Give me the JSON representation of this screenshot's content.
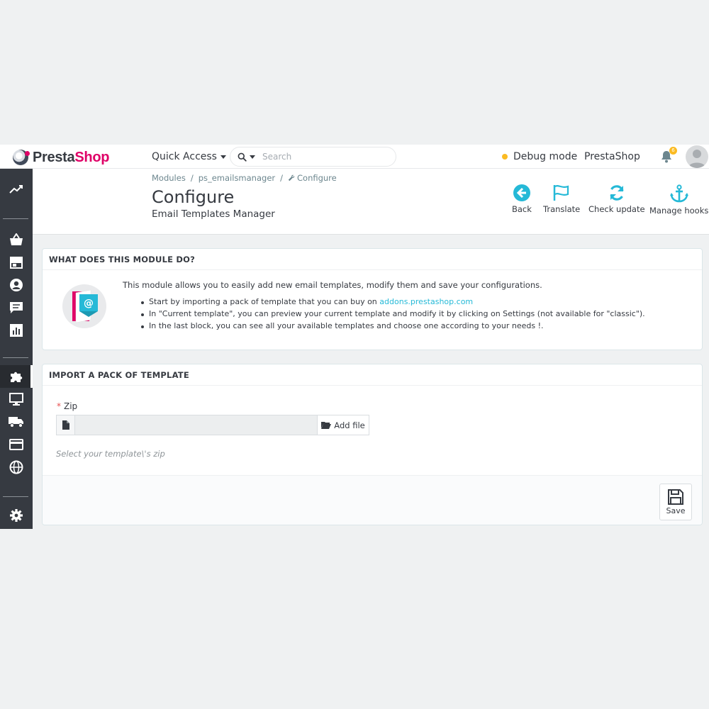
{
  "header": {
    "logo_text_a": "Presta",
    "logo_text_b": "Shop",
    "quick_access": "Quick Access",
    "search_placeholder": "Search",
    "debug_mode": "Debug mode",
    "shop_name": "PrestaShop",
    "notification_count": "6"
  },
  "breadcrumb": [
    "Modules",
    "ps_emailsmanager",
    "Configure"
  ],
  "page": {
    "title": "Configure",
    "subtitle": "Email Templates Manager"
  },
  "toolbar_buttons": [
    {
      "label": "Back",
      "icon": "arrow-circle-left-icon"
    },
    {
      "label": "Translate",
      "icon": "flag-icon"
    },
    {
      "label": "Check update",
      "icon": "refresh-icon"
    },
    {
      "label": "Manage hooks",
      "icon": "anchor-icon"
    }
  ],
  "sidebar": {
    "items": [
      "stats-trend-icon",
      "basket-icon",
      "store-icon",
      "user-icon",
      "message-icon",
      "bar-chart-icon",
      "puzzle-icon",
      "monitor-icon",
      "truck-icon",
      "credit-card-icon",
      "globe-icon",
      "gear-icon"
    ],
    "active": "puzzle-icon"
  },
  "module_panel": {
    "heading": "WHAT DOES THIS MODULE DO?",
    "intro": "This module allows you to easily add new email templates, modify them and save your configurations.",
    "bullet1_text": "Start by importing a pack of template that you can buy on ",
    "bullet1_link": "addons.prestashop.com",
    "bullet2": "In \"Current template\", you can preview your current template and modify it by clicking on Settings (not available for \"classic\").",
    "bullet3": "In the last block, you can see all your available templates and choose one according to your needs !."
  },
  "import_panel": {
    "heading": "IMPORT A PACK OF TEMPLATE",
    "required_mark": "*",
    "zip_label": "Zip",
    "add_file": "Add file",
    "help_text": "Select your template\\'s zip",
    "save": "Save"
  },
  "colors": {
    "accent": "#25b9d7",
    "brand": "#df0067",
    "sidebar": "#363a41",
    "debug_dot": "#fbbb22"
  }
}
